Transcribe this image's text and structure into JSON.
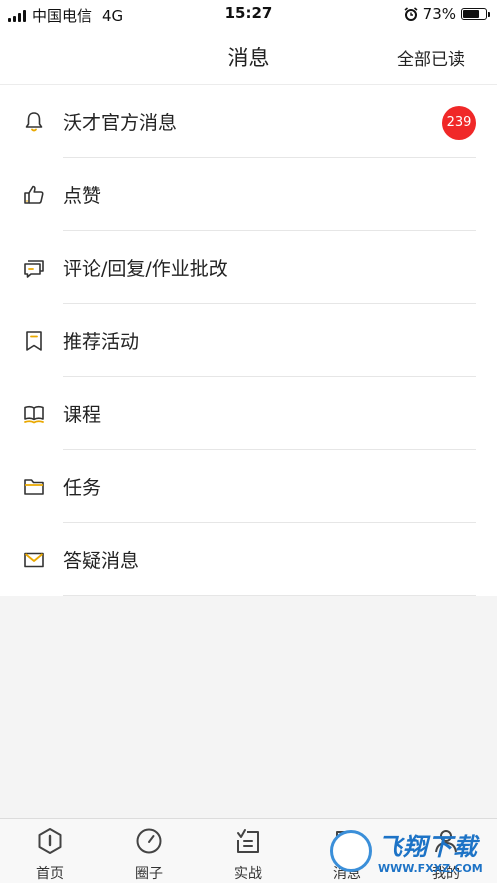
{
  "status_bar": {
    "carrier": "中国电信",
    "network": "4G",
    "time": "15:27",
    "battery": "73%",
    "battery_level": 0.73
  },
  "header": {
    "title": "消息",
    "mark_all_read": "全部已读"
  },
  "messages": [
    {
      "label": "沃才官方消息",
      "icon": "bell-icon",
      "badge": "239"
    },
    {
      "label": "点赞",
      "icon": "thumbs-up-icon"
    },
    {
      "label": "评论/回复/作业批改",
      "icon": "comment-icon"
    },
    {
      "label": "推荐活动",
      "icon": "bookmark-icon"
    },
    {
      "label": "课程",
      "icon": "book-icon"
    },
    {
      "label": "任务",
      "icon": "folder-icon"
    },
    {
      "label": "答疑消息",
      "icon": "envelope-icon"
    }
  ],
  "tabs": [
    {
      "label": "首页",
      "icon": "home-icon"
    },
    {
      "label": "圈子",
      "icon": "compass-icon"
    },
    {
      "label": "实战",
      "icon": "clipboard-icon"
    },
    {
      "label": "消息",
      "icon": "message-icon"
    },
    {
      "label": "我的",
      "icon": "profile-icon"
    }
  ],
  "watermark": {
    "title": "飞翔下载",
    "url": "WWW.FXXZ.COM"
  },
  "colors": {
    "badge": "#f02828",
    "icon_accent": "#e9a800",
    "watermark": "#1d73c6"
  }
}
